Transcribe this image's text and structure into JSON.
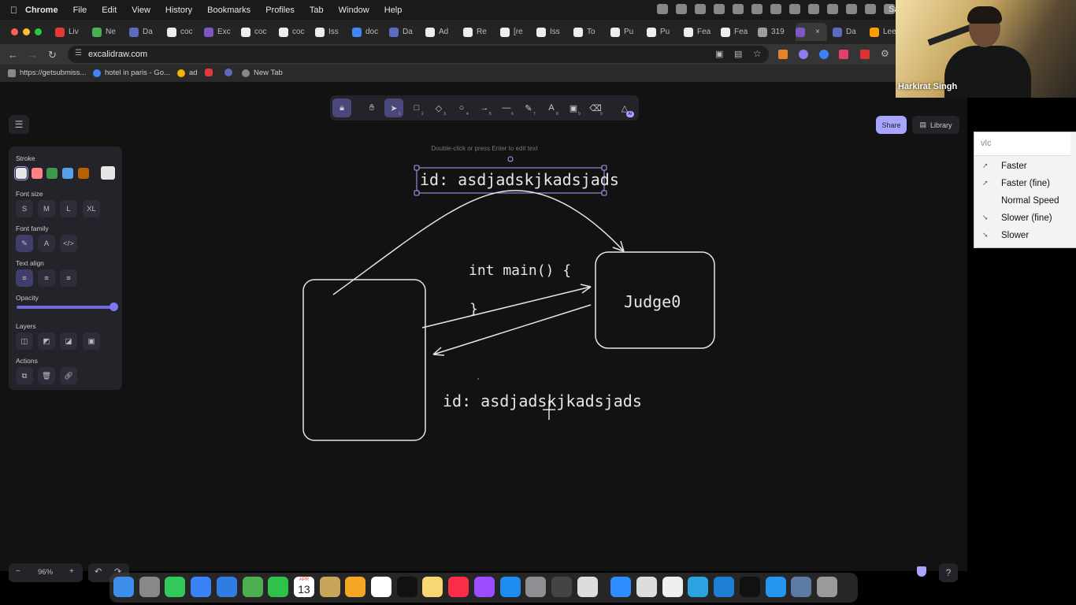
{
  "menubar": {
    "app": "Chrome",
    "items": [
      "File",
      "Edit",
      "View",
      "History",
      "Bookmarks",
      "Profiles",
      "Tab",
      "Window",
      "Help"
    ],
    "clock_partial": "Sa"
  },
  "tabs": [
    {
      "label": "Liv",
      "color": "#e53935"
    },
    {
      "label": "Ne",
      "color": "#4caf50"
    },
    {
      "label": "Da",
      "color": "#5c6bc0"
    },
    {
      "label": "coc",
      "color": "#eeeeee"
    },
    {
      "label": "Exc",
      "color": "#7e57c2"
    },
    {
      "label": "coc",
      "color": "#eeeeee"
    },
    {
      "label": "coc",
      "color": "#eeeeee"
    },
    {
      "label": "Iss",
      "color": "#eeeeee"
    },
    {
      "label": "doc",
      "color": "#4285f4"
    },
    {
      "label": "Da",
      "color": "#5c6bc0"
    },
    {
      "label": "Ad",
      "color": "#eeeeee"
    },
    {
      "label": "Re",
      "color": "#eeeeee"
    },
    {
      "label": "[re",
      "color": "#eeeeee"
    },
    {
      "label": "Iss",
      "color": "#eeeeee"
    },
    {
      "label": "To",
      "color": "#eeeeee"
    },
    {
      "label": "Pu",
      "color": "#eeeeee"
    },
    {
      "label": "Pu",
      "color": "#eeeeee"
    },
    {
      "label": "Fea",
      "color": "#eeeeee"
    },
    {
      "label": "Fea",
      "color": "#eeeeee"
    },
    {
      "label": "319",
      "color": "#9e9e9e"
    },
    {
      "label": "",
      "color": "#7e57c2"
    },
    {
      "label": "Da",
      "color": "#5c6bc0"
    },
    {
      "label": "Lee",
      "color": "#ffa000"
    }
  ],
  "address_bar": {
    "url": "excalidraw.com"
  },
  "bookmarks": [
    {
      "label": "https://getsubmiss...",
      "color": "#888"
    },
    {
      "label": "hotel in paris - Go...",
      "color": "#4285f4"
    },
    {
      "label": "ad",
      "color": "#f4b400"
    },
    {
      "label": "",
      "color": "#e53935"
    },
    {
      "label": "",
      "color": "#5c6bc0"
    },
    {
      "label": "New Tab",
      "color": "#888"
    }
  ],
  "excalidraw": {
    "hint": "Double-click or press Enter to edit text",
    "share_label": "Share",
    "library_label": "Library",
    "tool_ai_badge": "AI",
    "tool_shortcuts": [
      "1",
      "2",
      "3",
      "4",
      "5",
      "6",
      "7",
      "8",
      "9",
      "0"
    ],
    "properties": {
      "stroke_label": "Stroke",
      "stroke_colors": [
        "#e6e6e6",
        "#ff8383",
        "#3a994c",
        "#56a2e8",
        "#b76100"
      ],
      "current_stroke": "#e6e6e6",
      "font_size_label": "Font size",
      "font_sizes": [
        "S",
        "M",
        "L",
        "XL"
      ],
      "font_family_label": "Font family",
      "font_family_icons": [
        "pencil-icon",
        "letter-a-icon",
        "code-icon"
      ],
      "text_align_label": "Text align",
      "text_align_icons": [
        "align-left-icon",
        "align-center-icon",
        "align-right-icon"
      ],
      "opacity_label": "Opacity",
      "opacity_value": 1.0,
      "layers_label": "Layers",
      "actions_label": "Actions"
    },
    "zoom": {
      "minus": "−",
      "value": "96%",
      "plus": "+"
    },
    "canvas_text": {
      "selected_text": "id: asdjadskjkadsjads",
      "code_line1": "int main() {",
      "code_line2": "}",
      "judge_label": "Judge0",
      "bottom_text": "id: asdjadskjkadsjads"
    }
  },
  "webcam": {
    "name": "Harkirat Singh"
  },
  "vlc_menu": {
    "search_placeholder": "vlc",
    "items": [
      "Faster",
      "Faster (fine)",
      "Normal Speed",
      "Slower (fine)",
      "Slower"
    ]
  },
  "dock": {
    "calendar_month": "APR",
    "calendar_day": "13",
    "apps": [
      {
        "name": "finder-icon",
        "color": "#3d8eea"
      },
      {
        "name": "launchpad-icon",
        "color": "#888"
      },
      {
        "name": "messages-icon",
        "color": "#34c759"
      },
      {
        "name": "mail-icon",
        "color": "#3b82f6"
      },
      {
        "name": "safari-icon",
        "color": "#2f7de0"
      },
      {
        "name": "maps-icon",
        "color": "#4caf50"
      },
      {
        "name": "facetime-icon",
        "color": "#2ec24a"
      },
      {
        "name": "calendar-icon",
        "color": "#ffffff"
      },
      {
        "name": "notes-folder-icon",
        "color": "#c8a45c"
      },
      {
        "name": "photos-icon",
        "color": "#f5a623"
      },
      {
        "name": "reminders-icon",
        "color": "#ffffff"
      },
      {
        "name": "appletv-icon",
        "color": "#111111"
      },
      {
        "name": "notes-icon",
        "color": "#f7d774"
      },
      {
        "name": "music-icon",
        "color": "#fa2d48"
      },
      {
        "name": "podcasts-icon",
        "color": "#9b4dff"
      },
      {
        "name": "appstore-icon",
        "color": "#1e8cf0"
      },
      {
        "name": "settings-icon",
        "color": "#8e8e93"
      },
      {
        "name": "activity-monitor-icon",
        "color": "#444444"
      },
      {
        "name": "preview-icon",
        "color": "#dddddd"
      },
      {
        "name": "zoom-icon",
        "color": "#2d8cff"
      },
      {
        "name": "chrome-icon",
        "color": "#dddddd"
      },
      {
        "name": "textedit-icon",
        "color": "#eeeeee"
      },
      {
        "name": "telegram-icon",
        "color": "#2aa3e0"
      },
      {
        "name": "vscode-icon",
        "color": "#1f7ed4"
      },
      {
        "name": "terminal-icon",
        "color": "#111111"
      },
      {
        "name": "docker-icon",
        "color": "#2496ed"
      },
      {
        "name": "screens-icon",
        "color": "#5d7aa3"
      },
      {
        "name": "trash-icon",
        "color": "#9a9a9a"
      }
    ]
  }
}
